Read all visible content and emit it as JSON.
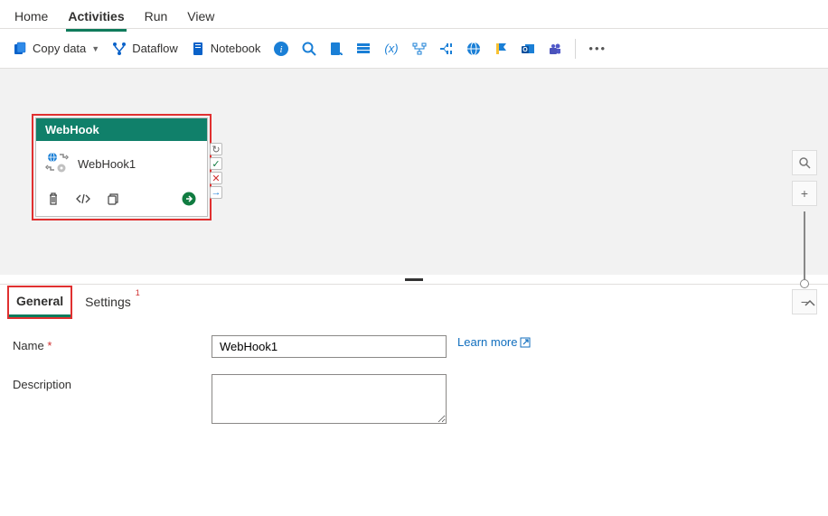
{
  "topTabs": {
    "home": "Home",
    "activities": "Activities",
    "run": "Run",
    "view": "View"
  },
  "toolbar": {
    "copyData": "Copy data",
    "dataflow": "Dataflow",
    "notebook": "Notebook"
  },
  "activity": {
    "type": "WebHook",
    "name": "WebHook1"
  },
  "bottomTabs": {
    "general": "General",
    "settings": "Settings",
    "settingsBadge": "1"
  },
  "form": {
    "nameLabel": "Name",
    "nameValue": "WebHook1",
    "descriptionLabel": "Description",
    "descriptionValue": "",
    "learnMore": "Learn more"
  }
}
